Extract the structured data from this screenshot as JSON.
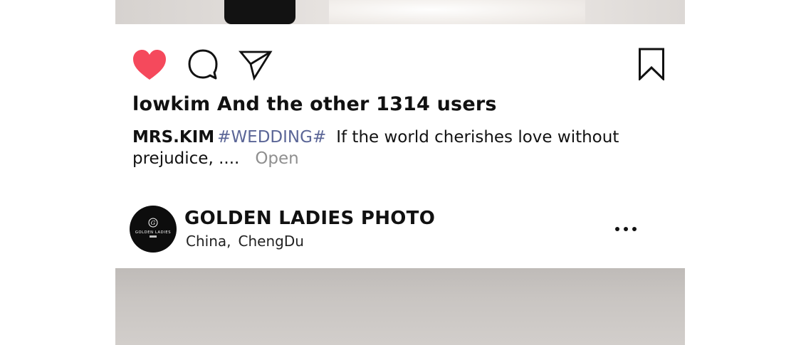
{
  "post_top": {
    "likes_text": "lowkim And the other 1314 users",
    "caption": {
      "username": "MRS.KIM",
      "hashtag": "#WEDDING#",
      "text": "If the world cherishes love without prejudice, ....",
      "open_label": "Open"
    },
    "icons": {
      "like": "heart-icon",
      "comment": "comment-icon",
      "share": "send-icon",
      "save": "bookmark-icon"
    },
    "colors": {
      "liked_heart": "#f5495c",
      "hashtag": "#5b6697",
      "open_link": "#8f8f8f"
    }
  },
  "post_next": {
    "account_name": "GOLDEN LADIES PHOTO",
    "location": {
      "country": "China,",
      "city": "ChengDu"
    },
    "avatar_text": "GOLDEN LADIES",
    "more_icon": "more-horizontal-icon"
  }
}
